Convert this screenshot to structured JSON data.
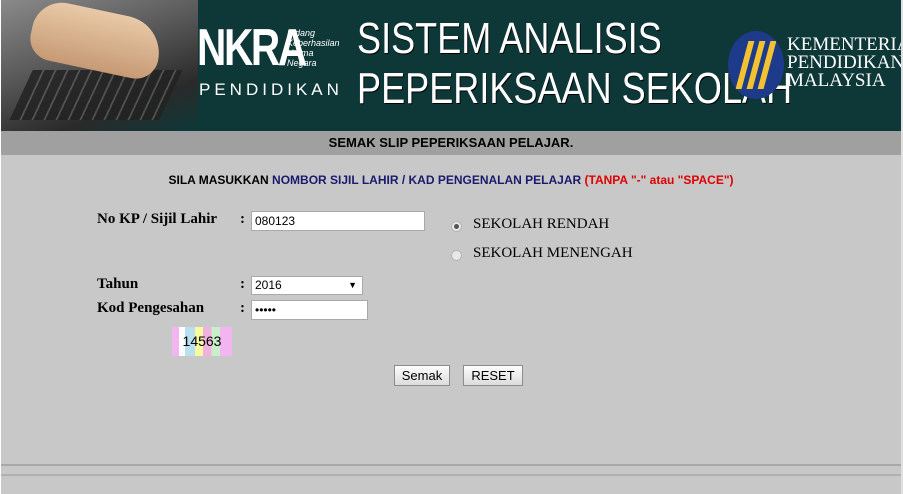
{
  "header": {
    "nkra": "NKRA",
    "nkra_sub": [
      "Bidang",
      "Keberhasilan",
      "Utama",
      "Negara"
    ],
    "pendidikan": "PENDIDIKAN",
    "title_line1": "SISTEM ANALISIS",
    "title_line2": "PEPERIKSAAN SEKOLAH",
    "ministry": [
      "KEMENTERIAN",
      "PENDIDIKAN",
      "MALAYSIA"
    ]
  },
  "title_bar": "SEMAK SLIP PEPERIKSAAN PELAJAR.",
  "instruction": {
    "part1": "SILA MASUKKAN ",
    "part2": "NOMBOR SIJIL LAHIR / KAD PENGENALAN PELAJAR",
    "part3": " (TANPA \"-\" atau \"SPACE\")"
  },
  "form": {
    "ic_label": "No KP / Sijil Lahir",
    "ic_value": "080123",
    "year_label": "Tahun",
    "year_value": "2016",
    "code_label": "Kod Pengesahan",
    "code_value": "•••••",
    "colon": ":",
    "captcha": "14563",
    "school_options": [
      {
        "label": "SEKOLAH RENDAH",
        "selected": true
      },
      {
        "label": "SEKOLAH MENENGAH",
        "selected": false
      }
    ],
    "submit_label": "Semak",
    "reset_label": "RESET"
  }
}
